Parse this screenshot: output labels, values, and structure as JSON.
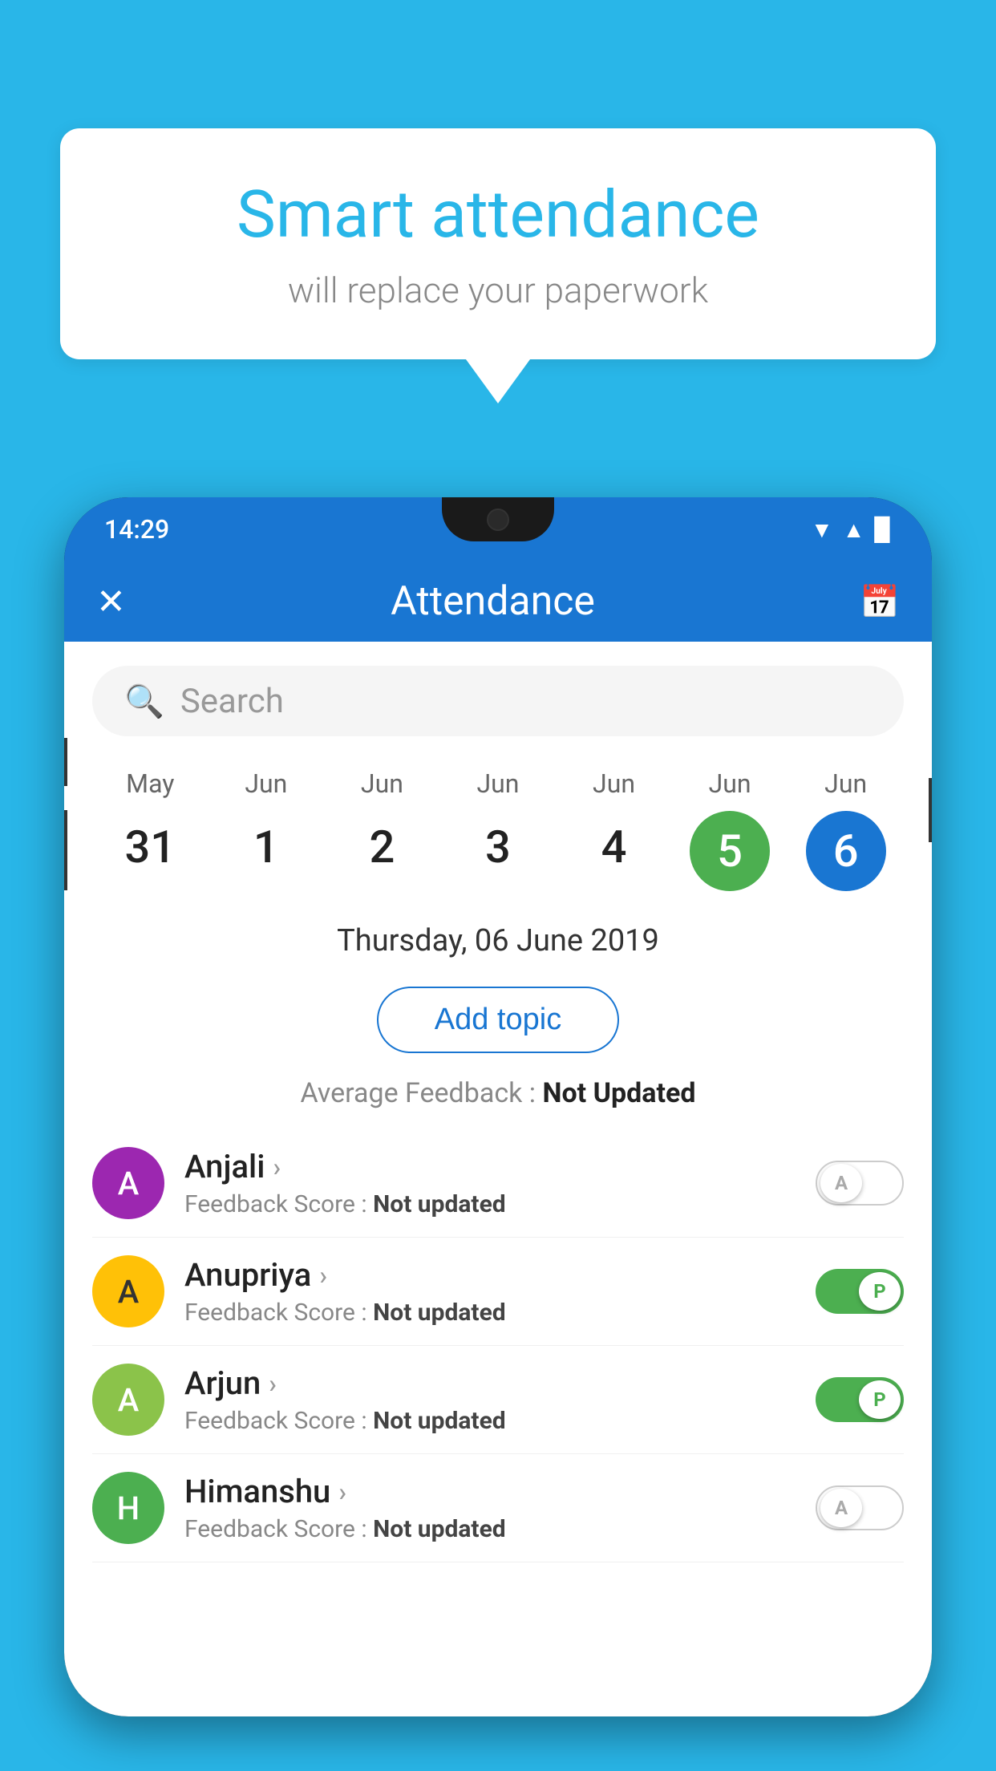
{
  "background_color": "#29B6E8",
  "hero": {
    "title": "Smart attendance",
    "subtitle": "will replace your paperwork"
  },
  "status_bar": {
    "time": "14:29",
    "wifi": "▼",
    "signal": "▲",
    "battery": "▉"
  },
  "app_header": {
    "title": "Attendance",
    "close_label": "✕",
    "calendar_icon": "📅"
  },
  "search": {
    "placeholder": "Search"
  },
  "calendar": {
    "days": [
      {
        "month": "May",
        "date": "31",
        "state": "normal"
      },
      {
        "month": "Jun",
        "date": "1",
        "state": "normal"
      },
      {
        "month": "Jun",
        "date": "2",
        "state": "normal"
      },
      {
        "month": "Jun",
        "date": "3",
        "state": "normal"
      },
      {
        "month": "Jun",
        "date": "4",
        "state": "normal"
      },
      {
        "month": "Jun",
        "date": "5",
        "state": "today"
      },
      {
        "month": "Jun",
        "date": "6",
        "state": "selected"
      }
    ]
  },
  "selected_date": "Thursday, 06 June 2019",
  "add_topic_label": "Add topic",
  "average_feedback": {
    "label": "Average Feedback : ",
    "value": "Not Updated"
  },
  "students": [
    {
      "name": "Anjali",
      "initial": "A",
      "avatar_color": "purple",
      "feedback": "Feedback Score : ",
      "feedback_value": "Not updated",
      "toggle_state": "off",
      "toggle_label": "A"
    },
    {
      "name": "Anupriya",
      "initial": "A",
      "avatar_color": "yellow",
      "feedback": "Feedback Score : ",
      "feedback_value": "Not updated",
      "toggle_state": "on",
      "toggle_label": "P"
    },
    {
      "name": "Arjun",
      "initial": "A",
      "avatar_color": "green-light",
      "feedback": "Feedback Score : ",
      "feedback_value": "Not updated",
      "toggle_state": "on",
      "toggle_label": "P"
    },
    {
      "name": "Himanshu",
      "initial": "H",
      "avatar_color": "green-dark",
      "feedback": "Feedback Score : ",
      "feedback_value": "Not updated",
      "toggle_state": "off",
      "toggle_label": "A"
    }
  ]
}
